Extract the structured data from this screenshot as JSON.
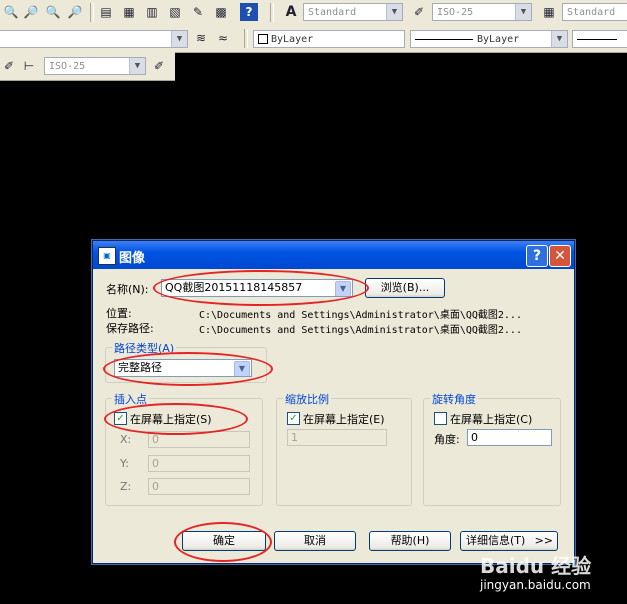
{
  "toolbar": {
    "text_style": "Standard",
    "dim_style": "ISO-25",
    "table_style": "Standard",
    "color_layer": "ByLayer",
    "linetype": "ByLayer",
    "dim_style_2": "ISO-25",
    "icons": [
      "zoom-realtime-icon",
      "zoom-window-icon",
      "zoom-previous-icon",
      "properties-icon",
      "design-center-icon",
      "tool-palette-icon",
      "markup-icon",
      "calculator-icon",
      "help-icon",
      "text-style-icon",
      "dim-style-icon",
      "table-style-icon",
      "layer-icon",
      "layer-previous-icon",
      "dim-update-icon"
    ]
  },
  "dialog": {
    "title": "图像",
    "help_button": "?",
    "close_button": "✕",
    "name_label": "名称(N):",
    "name_value": "QQ截图20151118145857",
    "browse_button": "浏览(B)...",
    "location_label": "位置:",
    "location_value": "C:\\Documents and Settings\\Administrator\\桌面\\QQ截图2...",
    "saved_path_label": "保存路径:",
    "saved_path_value": "C:\\Documents and Settings\\Administrator\\桌面\\QQ截图2...",
    "path_type_label": "路径类型(A)",
    "path_type_value": "完整路径",
    "insert_point": {
      "title": "插入点",
      "specify_label": "在屏幕上指定(S)",
      "specify_checked": true,
      "x_label": "X:",
      "x_value": "0",
      "y_label": "Y:",
      "y_value": "0",
      "z_label": "Z:",
      "z_value": "0"
    },
    "scale": {
      "title": "缩放比例",
      "specify_label": "在屏幕上指定(E)",
      "specify_checked": true,
      "value": "1"
    },
    "rotation": {
      "title": "旋转角度",
      "specify_label": "在屏幕上指定(C)",
      "specify_checked": false,
      "angle_label": "角度:",
      "angle_value": "0"
    },
    "ok_button": "确定",
    "cancel_button": "取消",
    "help_btn": "帮助(H)",
    "details_button": "详细信息(T)",
    "details_arrow": ">>"
  },
  "watermark": {
    "top": "Baidu 经验",
    "bottom": "jingyan.baidu.com"
  },
  "colors": {
    "annotation": "#e52525",
    "titlebar": "#0054e3",
    "dialog_bg": "#ece9d8",
    "canvas": "#000000"
  }
}
